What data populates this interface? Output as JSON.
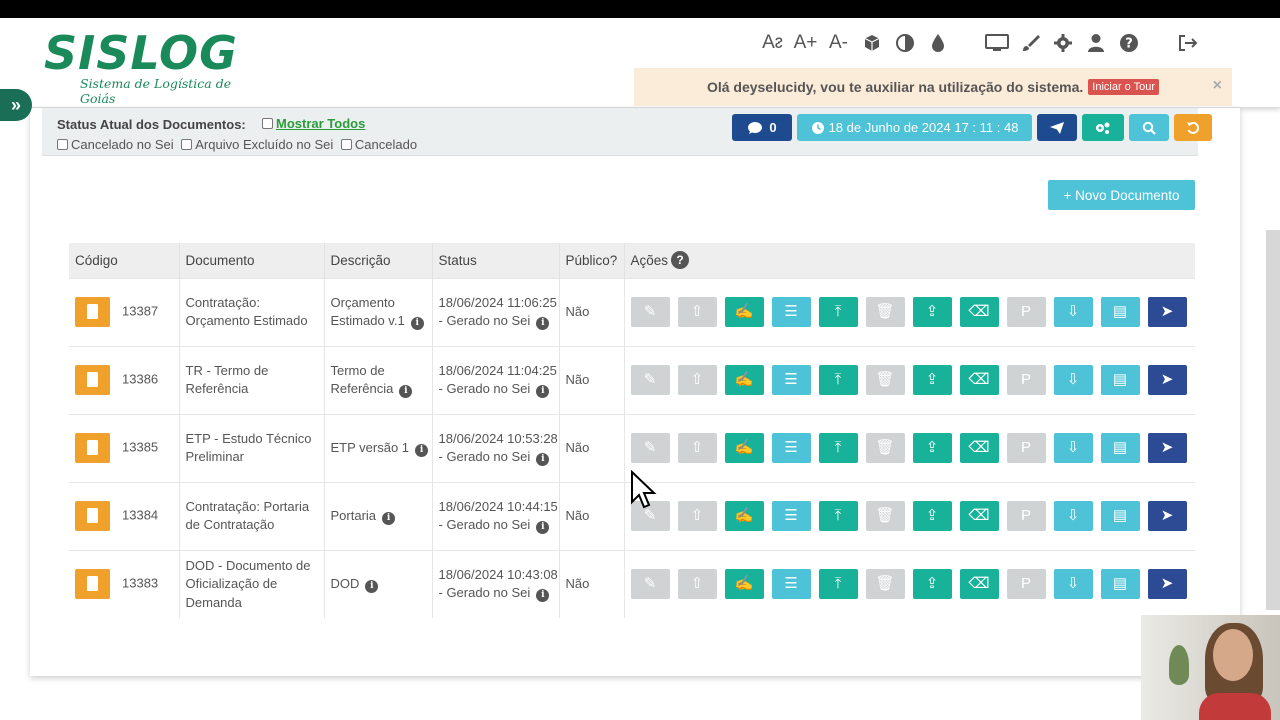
{
  "header": {
    "logo_main": "SISLOG",
    "logo_sub": "Sistema de Logística de Goiás"
  },
  "toolbar": {
    "icons": [
      "font-reset-icon",
      "font-increase-icon",
      "font-decrease-icon",
      "cube-icon",
      "contrast-icon",
      "drop-icon",
      "monitor-icon",
      "brush-icon",
      "gear-icon",
      "user-icon",
      "help-icon",
      "logout-icon"
    ],
    "font_reset": "Aᴤ",
    "font_increase": "A+",
    "font_decrease": "A-"
  },
  "tour": {
    "message": "Olá deyselucidy, vou te auxiliar na utilização do sistema.",
    "button": "Iniciar o Tour",
    "close": "×"
  },
  "status": {
    "title": "Status Atual dos Documentos:",
    "show_all": "Mostrar Todos",
    "filters": [
      "Cancelado no Sei",
      "Arquivo Excluído no Sei",
      "Cancelado"
    ]
  },
  "top_buttons": {
    "comments_count": "0",
    "datetime": "18 de Junho de 2024 17 : 11 : 48"
  },
  "new_document": "+ Novo Documento",
  "table": {
    "columns": [
      "Código",
      "Documento",
      "Descrição",
      "Status",
      "Público?",
      "Ações"
    ],
    "rows": [
      {
        "code": "13387",
        "document": "Contratação: Orçamento Estimado",
        "description": "Orçamento Estimado v.1",
        "status": "18/06/2024 11:06:25 - Gerado no Sei",
        "public": "Não"
      },
      {
        "code": "13386",
        "document": "TR - Termo de Referência",
        "description": "Termo de Referência",
        "status": "18/06/2024 11:04:25 - Gerado no Sei",
        "public": "Não"
      },
      {
        "code": "13385",
        "document": "ETP - Estudo Técnico Preliminar",
        "description": "ETP versão 1",
        "status": "18/06/2024 10:53:28 - Gerado no Sei",
        "public": "Não"
      },
      {
        "code": "13384",
        "document": "Contratação: Portaria de Contratação",
        "description": "Portaria",
        "status": "18/06/2024 10:44:15 - Gerado no Sei",
        "public": "Não"
      },
      {
        "code": "13383",
        "document": "DOD - Documento de Oficialização de Demanda",
        "description": "DOD",
        "status": "18/06/2024 10:43:08 - Gerado no Sei",
        "public": "Não"
      }
    ],
    "action_buttons": [
      {
        "name": "edit-button",
        "icon": "✎",
        "color": "g"
      },
      {
        "name": "upload-small-button",
        "icon": "⇧",
        "color": "g"
      },
      {
        "name": "sign-button",
        "icon": "✍",
        "color": "t"
      },
      {
        "name": "list-button",
        "icon": "☰",
        "color": "c"
      },
      {
        "name": "upload-button",
        "icon": "⤒",
        "color": "t"
      },
      {
        "name": "delete-button",
        "icon": "🗑",
        "color": "g"
      },
      {
        "name": "trash-upload-button",
        "icon": "⇪",
        "color": "t"
      },
      {
        "name": "erase-button",
        "icon": "⌫",
        "color": "t"
      },
      {
        "name": "p-button",
        "icon": "P",
        "color": "g"
      },
      {
        "name": "download-button",
        "icon": "⇩",
        "color": "c"
      },
      {
        "name": "pdf-button",
        "icon": "▤",
        "color": "c"
      },
      {
        "name": "send-button",
        "icon": "➤",
        "color": "n"
      }
    ]
  }
}
